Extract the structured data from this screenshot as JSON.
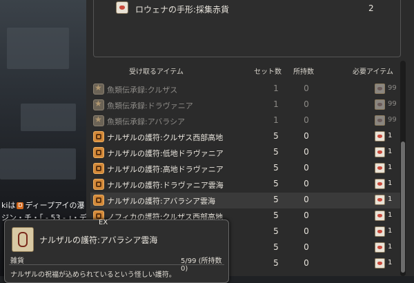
{
  "chat": {
    "line1_prefix": "kiは",
    "line1_tag": "D",
    "line1_text": "ディープアイの瀑",
    "line2_text": "ジン・チ・「 - 53 - 」・デ"
  },
  "top_item": {
    "name": "ロウェナの手形:採集赤貨",
    "value": "2"
  },
  "header": {
    "receive": "受け取るアイテム",
    "sets": "セット数",
    "owned": "所持数",
    "required": "必要アイテム"
  },
  "rows": [
    {
      "icon": "star-icon",
      "name": "魚類伝承録:クルザス",
      "sets": "1",
      "owned": "0",
      "need": "99",
      "dim": true
    },
    {
      "icon": "star-icon",
      "name": "魚類伝承録:ドラヴァニア",
      "sets": "1",
      "owned": "0",
      "need": "99",
      "dim": true
    },
    {
      "icon": "star-icon",
      "name": "魚類伝承録:アバラシア",
      "sets": "1",
      "owned": "0",
      "need": "99",
      "dim": true
    },
    {
      "icon": "amulet-icon",
      "name": "ナルザルの護符:クルザス西部高地",
      "sets": "5",
      "owned": "0",
      "need": "1",
      "dim": false
    },
    {
      "icon": "amulet-icon",
      "name": "ナルザルの護符:低地ドラヴァニア",
      "sets": "5",
      "owned": "0",
      "need": "1",
      "dim": false
    },
    {
      "icon": "amulet-icon",
      "name": "ナルザルの護符:高地ドラヴァニア",
      "sets": "5",
      "owned": "0",
      "need": "1",
      "dim": false
    },
    {
      "icon": "amulet-icon",
      "name": "ナルザルの護符:ドラヴァニア雲海",
      "sets": "5",
      "owned": "0",
      "need": "1",
      "dim": false
    },
    {
      "icon": "amulet-icon",
      "name": "ナルザルの護符:アバラシア雲海",
      "sets": "5",
      "owned": "0",
      "need": "1",
      "dim": false,
      "selected": true
    },
    {
      "icon": "amulet-icon",
      "name": "ノフィカの護符:クルザス西部高地",
      "sets": "5",
      "owned": "0",
      "need": "1",
      "dim": false
    },
    {
      "icon": "amulet-icon",
      "name": "",
      "sets": "5",
      "owned": "0",
      "need": "1",
      "dim": false
    },
    {
      "icon": "amulet-icon",
      "name": "",
      "sets": "5",
      "owned": "0",
      "need": "1",
      "dim": false
    },
    {
      "icon": "amulet-icon",
      "name": "",
      "sets": "5",
      "owned": "0",
      "need": "1",
      "dim": false
    }
  ],
  "tooltip": {
    "ex_label": "EX",
    "name": "ナルザルの護符:アバラシア雲海",
    "category": "雑貨",
    "count": "5/99 (所持数0)",
    "description": "ナルザルの祝福が込められているという怪しい護符。"
  }
}
